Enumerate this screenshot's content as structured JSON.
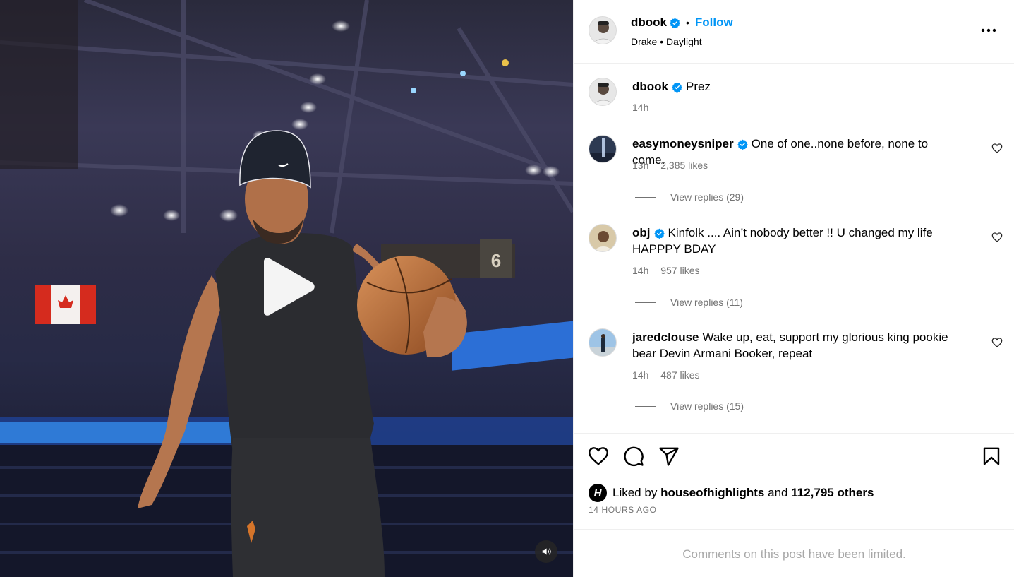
{
  "header": {
    "username": "dbook",
    "verified": true,
    "separator": "•",
    "follow_label": "Follow",
    "audio": "Drake • Daylight"
  },
  "caption": {
    "username": "dbook",
    "verified": true,
    "text": "Prez",
    "time": "14h"
  },
  "comments": [
    {
      "username": "easymoneysniper",
      "verified": true,
      "text": "One of one..none before, none to come.",
      "time": "13h",
      "likes": "2,385 likes",
      "replies": "View replies (29)"
    },
    {
      "username": "obj",
      "verified": true,
      "text": "Kinfolk .... Ain’t nobody better !! U changed my life HAPPPY BDAY",
      "time": "14h",
      "likes": "957 likes",
      "replies": "View replies (11)"
    },
    {
      "username": "jaredclouse",
      "verified": false,
      "text": "Wake up, eat, support my glorious king pookie bear Devin Armani Booker, repeat",
      "time": "14h",
      "likes": "487 likes",
      "replies": "View replies (15)"
    }
  ],
  "actions": {
    "like_icon": "heart-icon",
    "comment_icon": "comment-icon",
    "share_icon": "share-icon",
    "save_icon": "bookmark-icon"
  },
  "liked_by": {
    "prefix": "Liked by",
    "user": "houseofhighlights",
    "conjunction": "and",
    "others": "112,795 others",
    "avatar_letter": "H"
  },
  "timestamp": "14 HOURS AGO",
  "comments_limited": "Comments on this post have been limited.",
  "colors": {
    "accent": "#0095f6",
    "secondary_text": "#737373",
    "muted_text": "#a8a8a8"
  }
}
